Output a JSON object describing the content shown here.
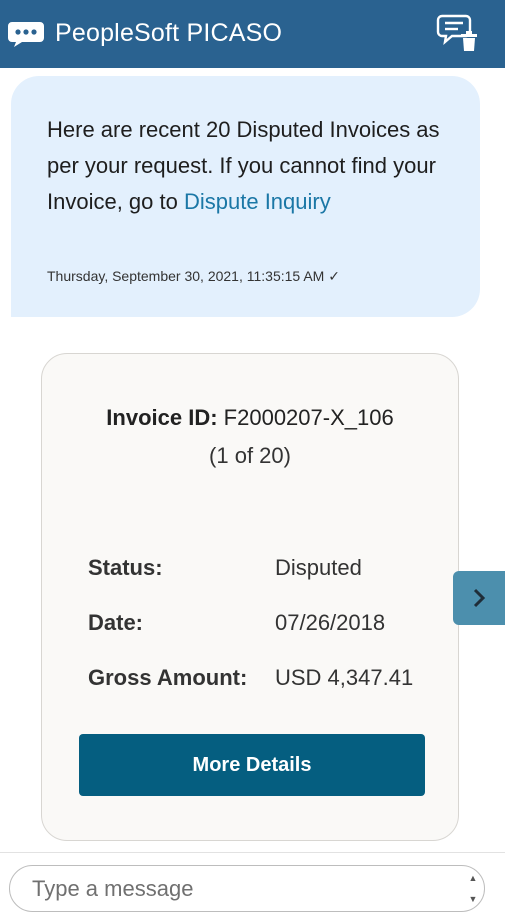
{
  "header": {
    "title": "PeopleSoft PICASO",
    "logo_icon": "chat-bubble-dots-icon",
    "clear_icon": "clear-chat-icon"
  },
  "message": {
    "text_before_link": "Here are recent 20 Disputed Invoices as per your request. If you cannot find your Invoice, go to ",
    "link_text": "Dispute Inquiry",
    "timestamp": "Thursday, September 30, 2021, 11:35:15 AM ✓"
  },
  "invoice_card": {
    "id_label": "Invoice ID:",
    "id_value": "F2000207-X_106",
    "count": "(1 of 20)",
    "fields": [
      {
        "label": "Status:",
        "value": "Disputed"
      },
      {
        "label": "Date:",
        "value": "07/26/2018"
      },
      {
        "label": "Gross Amount:",
        "value": "USD 4,347.41"
      }
    ],
    "button_label": "More Details",
    "next_icon": "chevron-right-icon"
  },
  "composer": {
    "placeholder": "Type a message"
  },
  "colors": {
    "header_bg": "#2a6290",
    "bubble_bg": "#e3f0fd",
    "link": "#1b77a6",
    "button_bg": "#055e80",
    "next_bg": "#4c8fad"
  }
}
